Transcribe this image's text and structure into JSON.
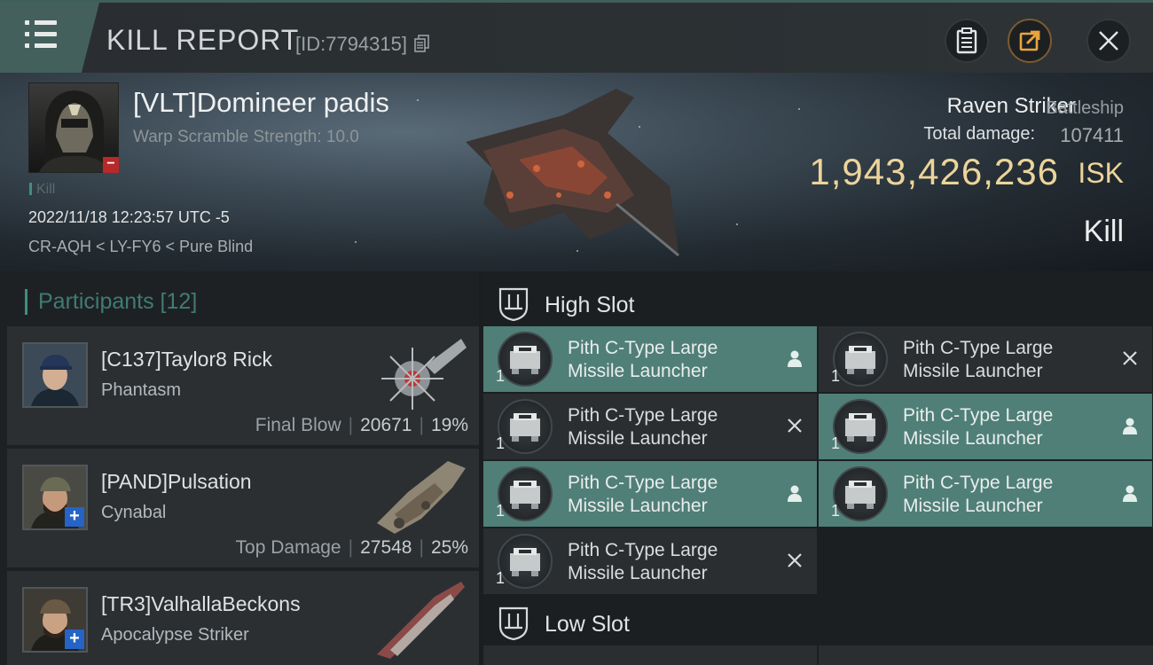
{
  "header": {
    "title": "KILL REPORT",
    "report_id": "[ID:7794315]"
  },
  "victim": {
    "name": "[VLT]Domineer padis",
    "warp_scramble": "Warp Scramble Strength: 10.0",
    "kill_tag": "Kill",
    "timestamp": "2022/11/18 12:23:57 UTC -5",
    "location": "CR-AQH < LY-FY6 < Pure Blind",
    "badge": "−"
  },
  "ship": {
    "name": "Raven Striker",
    "class": "Battleship",
    "total_damage_label": "Total damage:",
    "total_damage_value": "107411",
    "isk_value": "1,943,426,236",
    "isk_unit": "ISK",
    "result": "Kill"
  },
  "participants": {
    "header": "Participants [12]",
    "items": [
      {
        "name": "[C137]Taylor8 Rick",
        "ship": "Phantasm",
        "role": "Final Blow",
        "damage": "20671",
        "percent": "19%",
        "plus": ""
      },
      {
        "name": "[PAND]Pulsation",
        "ship": "Cynabal",
        "role": "Top Damage",
        "damage": "27548",
        "percent": "25%",
        "plus": "+"
      },
      {
        "name": "[TR3]ValhallaBeckons",
        "ship": "Apocalypse Striker",
        "role": "",
        "damage": "",
        "percent": "",
        "plus": "+"
      }
    ]
  },
  "fitting": {
    "high_slot_title": "High Slot",
    "low_slot_title": "Low Slot",
    "modules": [
      {
        "line1": "Pith C-Type Large",
        "line2": "Missile Launcher",
        "qty": "1",
        "state": "assigned"
      },
      {
        "line1": "Pith C-Type Large",
        "line2": "Missile Launcher",
        "qty": "1",
        "state": "destroyed"
      },
      {
        "line1": "Pith C-Type Large",
        "line2": "Missile Launcher",
        "qty": "1",
        "state": "destroyed"
      },
      {
        "line1": "Pith C-Type Large",
        "line2": "Missile Launcher",
        "qty": "1",
        "state": "assigned"
      },
      {
        "line1": "Pith C-Type Large",
        "line2": "Missile Launcher",
        "qty": "1",
        "state": "assigned"
      },
      {
        "line1": "Pith C-Type Large",
        "line2": "Missile Launcher",
        "qty": "1",
        "state": "assigned"
      },
      {
        "line1": "Pith C-Type Large",
        "line2": "Missile Launcher",
        "qty": "1",
        "state": "destroyed"
      }
    ]
  },
  "colors": {
    "accent_teal": "#3f8f80",
    "assigned_bg": "#4f7f77",
    "isk_gold": "#ecd49a",
    "minus_red": "#b8292a",
    "plus_blue": "#2563c7"
  },
  "icons": {
    "menu": "hamburger-menu-icon",
    "clipboard": "clipboard-icon",
    "share": "share-icon",
    "close": "close-icon",
    "copy": "copy-icon",
    "slot": "slot-shield-icon",
    "person": "person-icon",
    "destroyed": "x-icon"
  }
}
